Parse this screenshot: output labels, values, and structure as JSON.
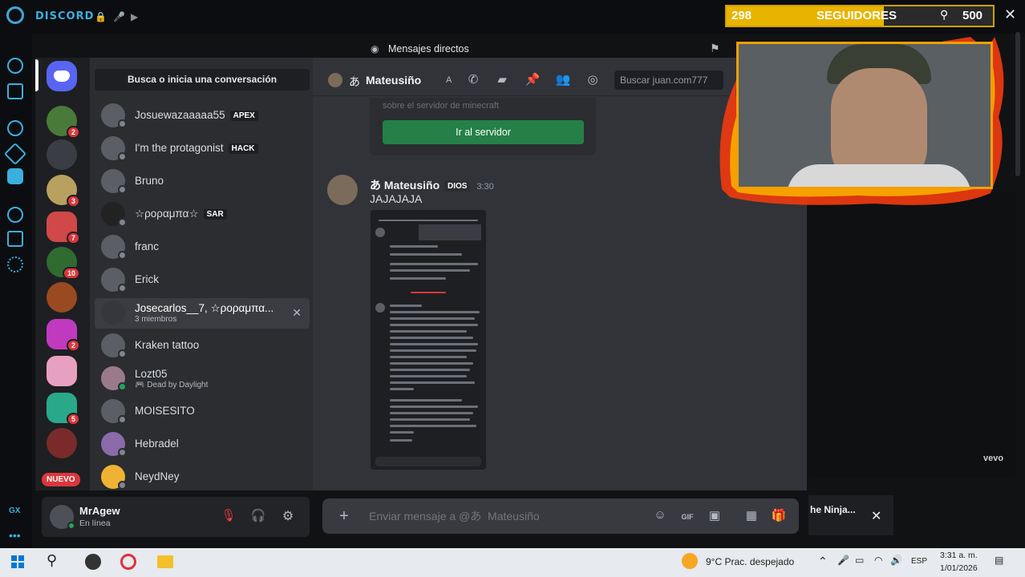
{
  "topbar": {
    "app_name": "DISCORD"
  },
  "header": {
    "title": "Mensajes directos"
  },
  "search_conv": "Busca o inicia una conversación",
  "servers": {
    "badges": [
      "2",
      "3",
      "7",
      "10",
      "2",
      "5"
    ],
    "new_label": "NUEVO"
  },
  "dm_list": [
    {
      "name": "Josuewazaaaaa55",
      "tag": "APEX"
    },
    {
      "name": "I'm the protagonist",
      "tag": "HACK"
    },
    {
      "name": "Bruno",
      "tag": ""
    },
    {
      "name": "☆ροραμπα☆",
      "tag": "SAR"
    },
    {
      "name": "franc",
      "tag": ""
    },
    {
      "name": "Erick",
      "tag": ""
    },
    {
      "name": "Josecarlos__7, ☆ροραμπα...",
      "tag": "",
      "sub": "3 miembros"
    },
    {
      "name": "Kraken tattoo",
      "tag": ""
    },
    {
      "name": "Lozt05",
      "tag": "",
      "sub": "Dead by Daylight"
    },
    {
      "name": "MOISESITO",
      "tag": ""
    },
    {
      "name": "Hebradel",
      "tag": ""
    },
    {
      "name": "NeydNey",
      "tag": ""
    }
  ],
  "user": {
    "name": "MrAgew",
    "status": "En línea"
  },
  "chat": {
    "header_name": "Mateusiño",
    "header_prefix": "あ",
    "header_extra": "A",
    "search_placeholder": "Buscar juan.com777",
    "embed_text": "sobre el servidor de minecraft",
    "go_server_label": "Ir al servidor",
    "message": {
      "author_prefix": "あ",
      "author": "Mateusiño",
      "role": "DIOS",
      "time": "3:30",
      "text": "JAJAJAJA"
    },
    "composer_placeholder": "Enviar mensaje a @あ  Mateusiño"
  },
  "overlay": {
    "followers_current": "298",
    "followers_label": "SEGUIDORES",
    "followers_goal": "500",
    "vevo": "vevo",
    "ninja_text": "he Ninja..."
  },
  "taskbar": {
    "weather": "9°C  Prac. despejado",
    "lang": "ESP",
    "time": "3:31 a. m.",
    "date": "1/01/2026"
  },
  "colors": {
    "accent_green": "#248046",
    "discord_blue": "#5865f2",
    "badge_red": "#da373c"
  }
}
